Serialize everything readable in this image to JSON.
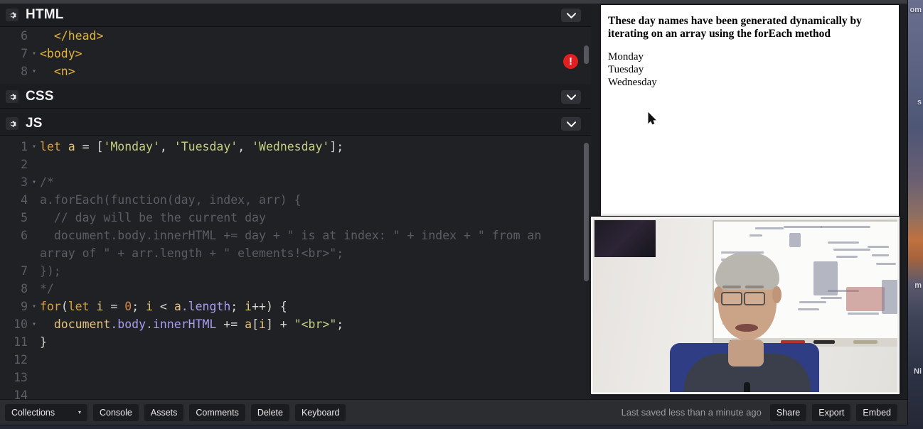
{
  "window": {
    "editors": [
      {
        "id": "html",
        "title": "HTML",
        "gear_icon": "gear-icon",
        "collapse_icon": "chevron-down-icon",
        "has_error_badge": true,
        "error_badge_glyph": "!",
        "lines": [
          {
            "num": "6",
            "fold": "",
            "tokens": [
              {
                "t": "plain",
                "s": "  "
              },
              {
                "t": "tag",
                "s": "</head>"
              }
            ]
          },
          {
            "num": "7",
            "fold": "▾",
            "tokens": [
              {
                "t": "tag",
                "s": "<body>"
              }
            ]
          },
          {
            "num": "8",
            "fold": "▾",
            "tokens": [
              {
                "t": "plain",
                "s": "  "
              },
              {
                "t": "tag",
                "s": "<n>"
              }
            ]
          }
        ]
      },
      {
        "id": "css",
        "title": "CSS",
        "gear_icon": "gear-icon",
        "collapse_icon": "chevron-down-icon",
        "has_error_badge": false,
        "lines": []
      },
      {
        "id": "js",
        "title": "JS",
        "gear_icon": "gear-icon",
        "collapse_icon": "chevron-down-icon",
        "has_error_badge": false,
        "lines": [
          {
            "num": "1",
            "fold": "▾",
            "tokens": [
              {
                "t": "kw",
                "s": "let"
              },
              {
                "t": "plain",
                "s": " "
              },
              {
                "t": "var",
                "s": "a"
              },
              {
                "t": "plain",
                "s": " = ["
              },
              {
                "t": "str",
                "s": "'Monday'"
              },
              {
                "t": "plain",
                "s": ", "
              },
              {
                "t": "str",
                "s": "'Tuesday'"
              },
              {
                "t": "plain",
                "s": ", "
              },
              {
                "t": "str",
                "s": "'Wednesday'"
              },
              {
                "t": "plain",
                "s": "];"
              }
            ]
          },
          {
            "num": "2",
            "fold": "",
            "tokens": []
          },
          {
            "num": "3",
            "fold": "▾",
            "tokens": [
              {
                "t": "com",
                "s": "/*"
              }
            ]
          },
          {
            "num": "4",
            "fold": "",
            "tokens": [
              {
                "t": "com",
                "s": "a.forEach(function(day, index, arr) {"
              }
            ]
          },
          {
            "num": "5",
            "fold": "",
            "tokens": [
              {
                "t": "com",
                "s": "  // day will be the current day"
              }
            ]
          },
          {
            "num": "6",
            "fold": "",
            "tokens": [
              {
                "t": "com",
                "s": "  document.body.innerHTML += day + \" is at index: \" + index + \" from an"
              }
            ]
          },
          {
            "num": "",
            "fold": "",
            "tokens": [
              {
                "t": "com",
                "s": "array of \" + arr.length + \" elements!<br>\";"
              }
            ]
          },
          {
            "num": "7",
            "fold": "",
            "tokens": [
              {
                "t": "com",
                "s": "});"
              }
            ]
          },
          {
            "num": "8",
            "fold": "",
            "tokens": [
              {
                "t": "com",
                "s": "*/"
              }
            ]
          },
          {
            "num": "9",
            "fold": "▾",
            "tokens": [
              {
                "t": "kw",
                "s": "for"
              },
              {
                "t": "plain",
                "s": "("
              },
              {
                "t": "kw",
                "s": "let"
              },
              {
                "t": "plain",
                "s": " "
              },
              {
                "t": "var",
                "s": "i"
              },
              {
                "t": "plain",
                "s": " = "
              },
              {
                "t": "num",
                "s": "0"
              },
              {
                "t": "plain",
                "s": "; "
              },
              {
                "t": "var",
                "s": "i"
              },
              {
                "t": "plain",
                "s": " < "
              },
              {
                "t": "var",
                "s": "a"
              },
              {
                "t": "prop",
                "s": ".length"
              },
              {
                "t": "plain",
                "s": "; "
              },
              {
                "t": "var",
                "s": "i"
              },
              {
                "t": "plain",
                "s": "++) {"
              }
            ]
          },
          {
            "num": "10",
            "fold": "▾",
            "tokens": [
              {
                "t": "plain",
                "s": "  "
              },
              {
                "t": "var",
                "s": "document"
              },
              {
                "t": "prop",
                "s": ".body"
              },
              {
                "t": "prop",
                "s": ".innerHTML"
              },
              {
                "t": "plain",
                "s": " += "
              },
              {
                "t": "var",
                "s": "a"
              },
              {
                "t": "plain",
                "s": "["
              },
              {
                "t": "var",
                "s": "i"
              },
              {
                "t": "plain",
                "s": "] + "
              },
              {
                "t": "str",
                "s": "\"<br>\""
              },
              {
                "t": "plain",
                "s": ";"
              }
            ]
          },
          {
            "num": "11",
            "fold": "",
            "tokens": [
              {
                "t": "plain",
                "s": "}"
              }
            ]
          },
          {
            "num": "12",
            "fold": "",
            "tokens": []
          },
          {
            "num": "13",
            "fold": "",
            "tokens": []
          },
          {
            "num": "14",
            "fold": "",
            "tokens": []
          }
        ]
      }
    ],
    "preview": {
      "heading": "These day names have been generated dynamically by iterating on an array using the forEach method",
      "items": [
        "Monday",
        "Tuesday",
        "Wednesday"
      ],
      "cursor_icon": "mouse-pointer-icon"
    },
    "webcam": {
      "label": "webcam-overlay"
    },
    "bottombar": {
      "collections_label": "Collections",
      "collections_caret": "▾",
      "buttons": [
        "Console",
        "Assets",
        "Comments",
        "Delete",
        "Keyboard"
      ],
      "saved_text": "Last saved less than a minute ago",
      "right_buttons": [
        "Share",
        "Export",
        "Embed"
      ]
    }
  },
  "desktop": {
    "edge_labels": [
      "om",
      "s",
      "m",
      "Ni"
    ]
  },
  "colors": {
    "accent_error": "#e02020",
    "editor_bg": "#202124",
    "chrome_bg": "#1d1e22",
    "bottombar_bg": "#2c2d30",
    "syntax_tag": "#e3b341",
    "syntax_keyword": "#d8a13a",
    "syntax_string": "#c3d082",
    "syntax_number": "#d1894a",
    "syntax_property": "#a99df0",
    "syntax_comment": "#5a5d64"
  }
}
